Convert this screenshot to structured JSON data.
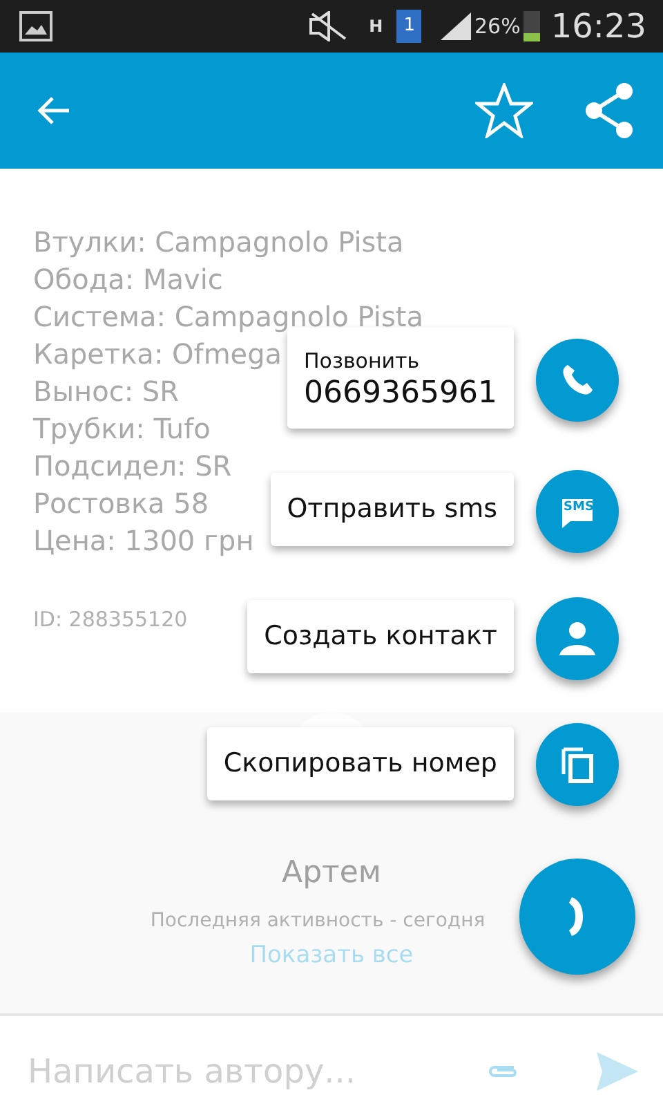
{
  "status_bar": {
    "network": "H",
    "sim": "1",
    "battery_text": "26%",
    "time": "16:23"
  },
  "app_bar": {
    "favorite": false
  },
  "specs": [
    "Втулки: Campagnolo Pista",
    "Обода: Mavic",
    "Система: Campagnolo Pista",
    "Каретка: Ofmega",
    "Вынос: SR",
    "Трубки: Tufo",
    "Подсидел: SR",
    "Ростовка 58",
    "Цена: 1300 грн"
  ],
  "listing_id": "ID: 288355120",
  "seller": {
    "name": "Артем",
    "activity": "Последняя активность - сегодня",
    "show_all": "Показать все"
  },
  "message": {
    "placeholder": "Написать автору..."
  },
  "actions": [
    {
      "kind": "call",
      "label": "Позвонить",
      "value": "0669365961"
    },
    {
      "kind": "sms",
      "label": "Отправить sms",
      "icon_text": "SMS"
    },
    {
      "kind": "contact",
      "label": "Создать контакт"
    },
    {
      "kind": "copy",
      "label": "Скопировать номер"
    }
  ]
}
